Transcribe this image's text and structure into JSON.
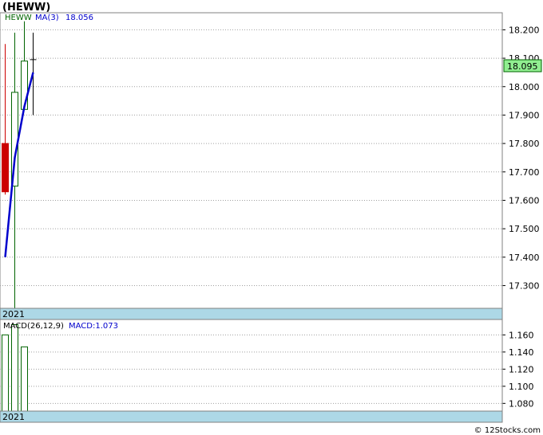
{
  "title": "(HEWW)",
  "footer": "© 12Stocks.com",
  "colors": {
    "up": "#006400",
    "down": "#cc0000",
    "ma": "#0000cc",
    "macd": "#006400",
    "band": "#add8e6",
    "last_price_bg": "#90ee90",
    "grid": "#a0a0a0"
  },
  "chart_data": [
    {
      "type": "candlestick",
      "legend": {
        "symbol": "HEWW",
        "ma_label": "MA(3)",
        "ma_value": "18.056"
      },
      "year_label": "2021",
      "y_ticks": [
        "17.300",
        "17.400",
        "17.500",
        "17.600",
        "17.700",
        "17.800",
        "17.900",
        "18.000",
        "18.100",
        "18.200"
      ],
      "ylim": [
        17.22,
        18.26
      ],
      "last_price": "18.095",
      "candles": [
        {
          "open": 17.8,
          "high": 18.15,
          "low": 17.62,
          "close": 17.63,
          "dir": "down"
        },
        {
          "open": 17.65,
          "high": 18.19,
          "low": 17.22,
          "close": 17.98,
          "dir": "up"
        },
        {
          "open": 17.92,
          "high": 18.23,
          "low": 17.92,
          "close": 18.09,
          "dir": "up"
        },
        {
          "open": 18.095,
          "high": 18.19,
          "low": 17.9,
          "close": 18.095,
          "dir": "doji"
        }
      ],
      "ma": [
        17.4,
        17.75,
        17.93,
        18.05
      ]
    },
    {
      "type": "bar",
      "legend": {
        "label": "MACD(26,12,9)",
        "value_label": "MACD:1.073"
      },
      "year_label": "2021",
      "y_ticks": [
        "1.080",
        "1.100",
        "1.120",
        "1.140",
        "1.160"
      ],
      "ylim": [
        1.071,
        1.178
      ],
      "values": [
        1.16,
        1.172,
        1.146
      ]
    }
  ]
}
